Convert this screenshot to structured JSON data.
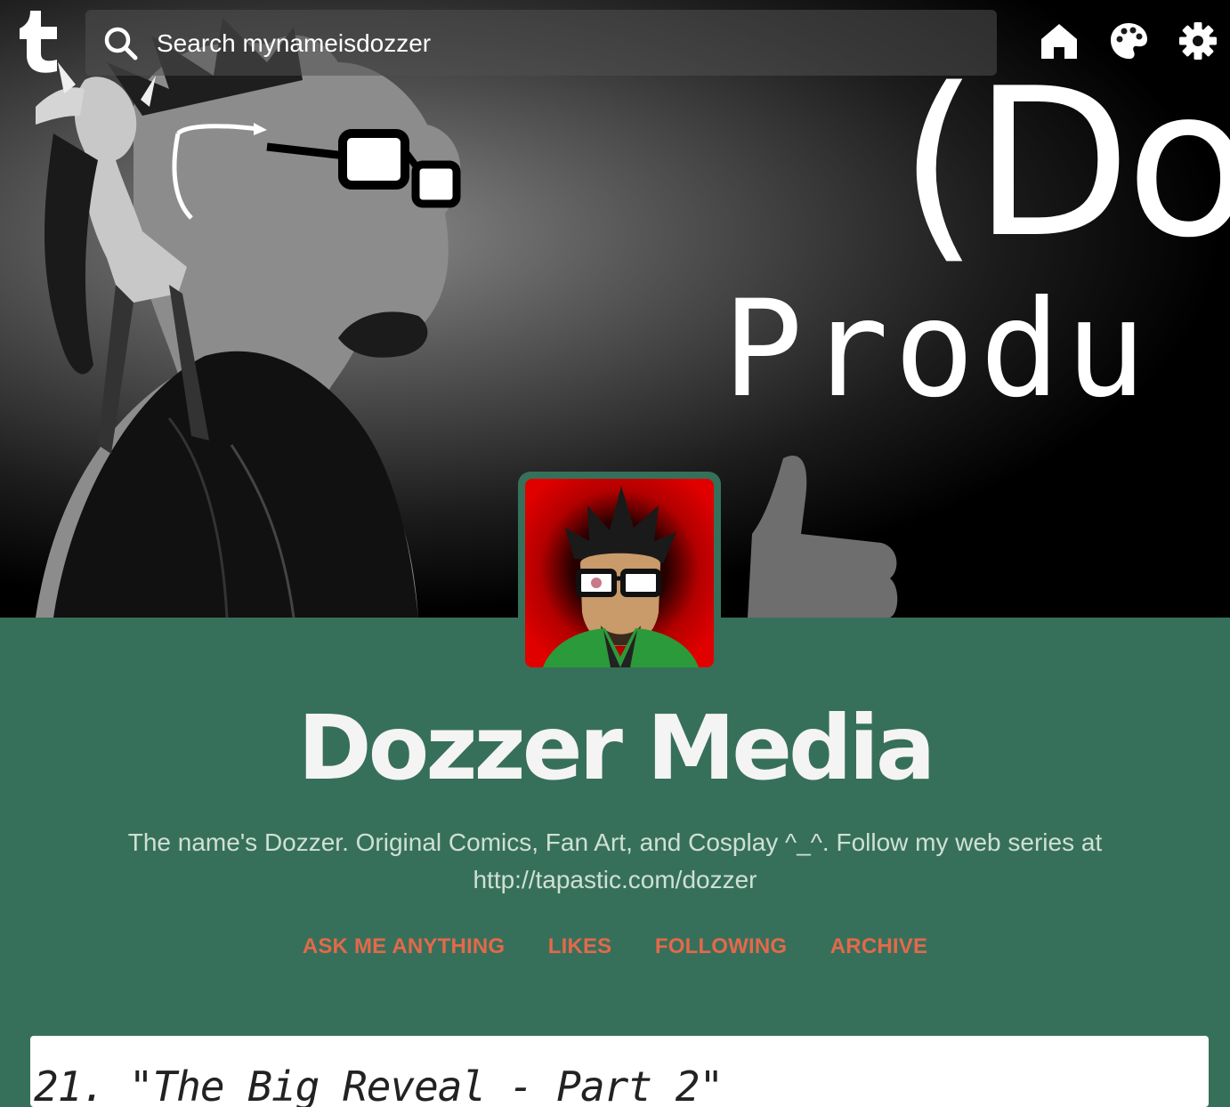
{
  "search": {
    "placeholder": "Search mynameisdozzer"
  },
  "header": {
    "banner_line_1": "(Do",
    "banner_line_2": "Produ"
  },
  "icons": {
    "logo": "tumblr-logo-icon",
    "search": "search-icon",
    "home": "home-icon",
    "palette": "palette-icon",
    "settings": "gear-icon"
  },
  "blog": {
    "title": "Dozzer Media",
    "description_line_1": "The name's Dozzer.  Original Comics, Fan Art, and Cosplay ^_^.  Follow my web series at",
    "description_line_2": "http://tapastic.com/dozzer"
  },
  "nav": {
    "ask": "ASK ME ANYTHING",
    "likes": "LIKES",
    "following": "FOLLOWING",
    "archive": "ARCHIVE"
  },
  "post": {
    "title": "21. \"The Big Reveal - Part 2\""
  },
  "colors": {
    "background": "#37705a",
    "accent": "#e3694a",
    "title": "#f4f4f4",
    "description": "#cfe0d6"
  }
}
